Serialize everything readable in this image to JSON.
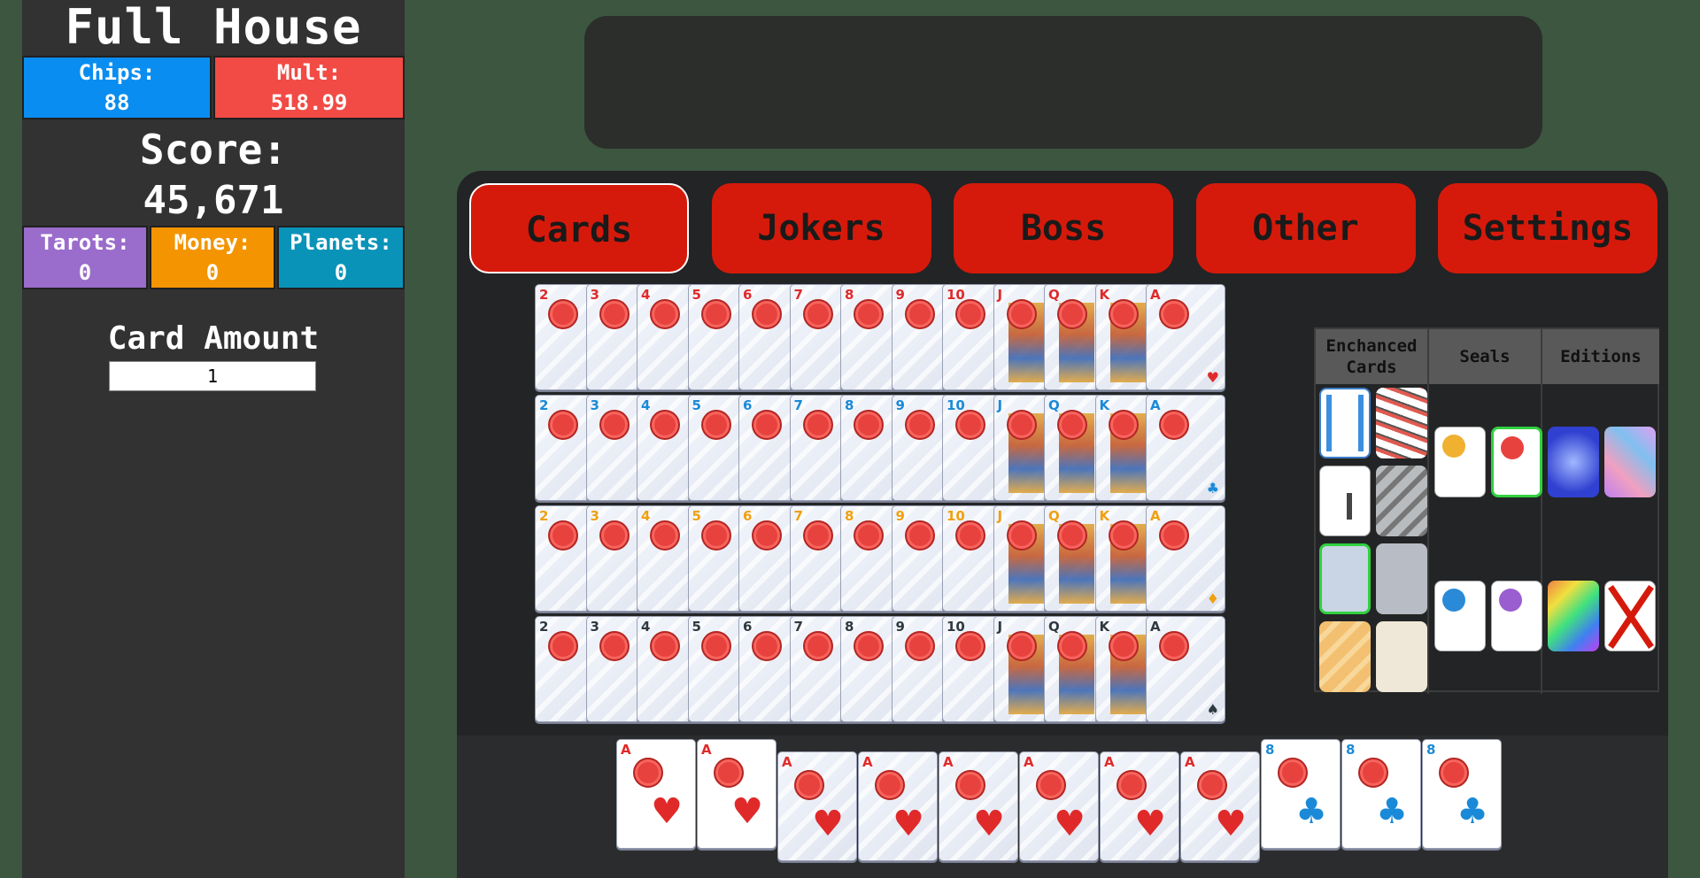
{
  "sidebar": {
    "hand_name": "Full House",
    "chips_label": "Chips:",
    "chips_value": "88",
    "mult_label": "Mult:",
    "mult_value": "518.99",
    "score_label": "Score:",
    "score_value": "45,671",
    "tarots_label": "Tarots:",
    "tarots_value": "0",
    "money_label": "Money:",
    "money_value": "0",
    "planets_label": "Planets:",
    "planets_value": "0",
    "card_amount_label": "Card Amount",
    "card_amount_value": "1"
  },
  "tabs": [
    {
      "label": "Cards",
      "active": true
    },
    {
      "label": "Jokers",
      "active": false
    },
    {
      "label": "Boss",
      "active": false
    },
    {
      "label": "Other",
      "active": false
    },
    {
      "label": "Settings",
      "active": false
    }
  ],
  "ranks": [
    "2",
    "3",
    "4",
    "5",
    "6",
    "7",
    "8",
    "9",
    "10",
    "J",
    "Q",
    "K",
    "A"
  ],
  "suits": [
    {
      "name": "hearts",
      "symbol": "♥",
      "color": "#e02a2a"
    },
    {
      "name": "clubs",
      "symbol": "♣",
      "color": "#1a8ad8"
    },
    {
      "name": "diamonds",
      "symbol": "♦",
      "color": "#f0a010"
    },
    {
      "name": "spades",
      "symbol": "♠",
      "color": "#2f3a3f"
    }
  ],
  "modifier_key": {
    "enhanced_header": "Enchanced Cards",
    "seals_header": "Seals",
    "editions_header": "Editions"
  },
  "hand": [
    {
      "rank": "A",
      "suit": "hearts",
      "raised": true,
      "enhanced": false
    },
    {
      "rank": "A",
      "suit": "hearts",
      "raised": true,
      "enhanced": false
    },
    {
      "rank": "A",
      "suit": "hearts",
      "raised": false,
      "enhanced": true
    },
    {
      "rank": "A",
      "suit": "hearts",
      "raised": false,
      "enhanced": true
    },
    {
      "rank": "A",
      "suit": "hearts",
      "raised": false,
      "enhanced": true
    },
    {
      "rank": "A",
      "suit": "hearts",
      "raised": false,
      "enhanced": true
    },
    {
      "rank": "A",
      "suit": "hearts",
      "raised": false,
      "enhanced": true
    },
    {
      "rank": "A",
      "suit": "hearts",
      "raised": false,
      "enhanced": true
    },
    {
      "rank": "8",
      "suit": "clubs",
      "raised": true,
      "enhanced": false
    },
    {
      "rank": "8",
      "suit": "clubs",
      "raised": true,
      "enhanced": false
    },
    {
      "rank": "8",
      "suit": "clubs",
      "raised": true,
      "enhanced": false
    }
  ],
  "colors": {
    "accent_red": "#d51a0b",
    "chips_blue": "#0a8df0",
    "mult_red": "#f24b45",
    "background": "#3c5640"
  }
}
